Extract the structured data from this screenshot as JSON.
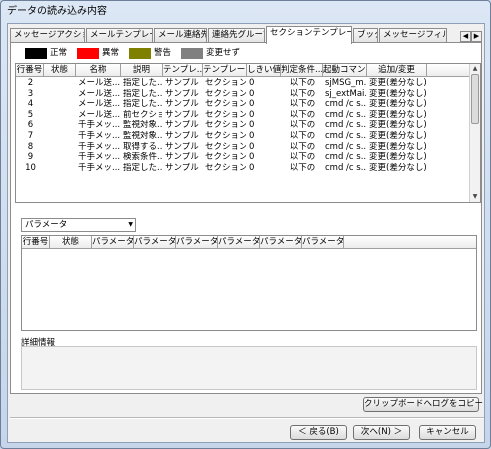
{
  "window": {
    "title": "データの読み込み内容"
  },
  "tabs": [
    {
      "label": "メッセージアクション"
    },
    {
      "label": "メールテンプレート"
    },
    {
      "label": "メール連絡先"
    },
    {
      "label": "連絡先グループ"
    },
    {
      "label": "セクションテンプレート"
    },
    {
      "label": "ブック"
    },
    {
      "label": "メッセージフィルタ"
    }
  ],
  "legend": [
    {
      "label": "正常",
      "color": "#000000"
    },
    {
      "label": "異常",
      "color": "#ff0000"
    },
    {
      "label": "警告",
      "color": "#808000"
    },
    {
      "label": "変更せず",
      "color": "#808080"
    }
  ],
  "table": {
    "columns": [
      "行番号",
      "状態",
      "名称",
      "説明",
      "テンプレ...",
      "テンプレー...",
      "しきい値",
      "判定条件...",
      "起動コマン...",
      "追加/変更"
    ],
    "rows": [
      [
        "2",
        "",
        "メール送...",
        "指定した...",
        "サンプル",
        "セクション...",
        "0",
        "以下の",
        "sjMSG_m...",
        "変更(差分なし)"
      ],
      [
        "3",
        "",
        "メール送...",
        "指定した...",
        "サンプル",
        "セクション...",
        "0",
        "以下の",
        "sj_extMai...",
        "変更(差分なし)"
      ],
      [
        "4",
        "",
        "メール送...",
        "指定した...",
        "サンプル",
        "セクション...",
        "0",
        "以下の",
        "cmd /c s...",
        "変更(差分なし)"
      ],
      [
        "5",
        "",
        "メール送...",
        "前セクショ...",
        "サンプル",
        "セクション...",
        "0",
        "以下の",
        "cmd /c s...",
        "変更(差分なし)"
      ],
      [
        "6",
        "",
        "千手メッ...",
        "監視対象...",
        "サンプル",
        "セクション...",
        "0",
        "以下の",
        "cmd /c s...",
        "変更(差分なし)"
      ],
      [
        "7",
        "",
        "千手メッ...",
        "監視対象...",
        "サンプル",
        "セクション...",
        "0",
        "以下の",
        "cmd /c s...",
        "変更(差分なし)"
      ],
      [
        "8",
        "",
        "千手メッ...",
        "取得する...",
        "サンプル",
        "セクション...",
        "0",
        "以下の",
        "cmd /c s...",
        "変更(差分なし)"
      ],
      [
        "9",
        "",
        "千手メッ...",
        "検索条件...",
        "サンプル",
        "セクション...",
        "0",
        "以下の",
        "cmd /c s...",
        "変更(差分なし)"
      ],
      [
        "10",
        "",
        "千手メッ...",
        "指定した...",
        "サンプル",
        "セクション...",
        "0",
        "以下の",
        "cmd /c s...",
        "変更(差分なし)"
      ]
    ]
  },
  "param_select": {
    "value": "パラメータ"
  },
  "param_table": {
    "columns": [
      "行番号",
      "状態",
      "パラメータ...",
      "パラメータ...",
      "パラメータ...",
      "パラメータ...",
      "パラメータ...",
      "パラメータ..."
    ]
  },
  "detail": {
    "label": "詳細情報"
  },
  "buttons": {
    "copy": "クリップボードへログをコピー",
    "back": "＜ 戻る(B)",
    "next": "次へ(N) ＞",
    "cancel": "キャンセル"
  }
}
